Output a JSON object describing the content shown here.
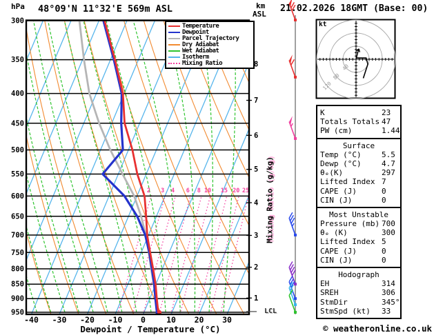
{
  "header": {
    "title": "48°09'N 11°32'E 569m ASL",
    "datetime": "21.02.2026 18GMT (Base: 00)"
  },
  "axes": {
    "pressure_unit": "hPa",
    "km_unit": "km",
    "asl_label": "ASL",
    "xlabel": "Dewpoint / Temperature (°C)",
    "mixing_axis_label": "Mixing Ratio (g/kg)",
    "lcl_label": "LCL",
    "pressure_ticks": [
      300,
      350,
      400,
      450,
      500,
      550,
      600,
      650,
      700,
      750,
      800,
      850,
      900,
      950
    ],
    "temp_ticks": [
      -40,
      -30,
      -20,
      -10,
      0,
      10,
      20,
      30
    ],
    "km_ticks": [
      {
        "km": 1,
        "p": 898
      },
      {
        "km": 2,
        "p": 795
      },
      {
        "km": 3,
        "p": 701
      },
      {
        "km": 4,
        "p": 616
      },
      {
        "km": 5,
        "p": 540
      },
      {
        "km": 6,
        "p": 472
      },
      {
        "km": 7,
        "p": 411
      },
      {
        "km": 8,
        "p": 356
      }
    ],
    "mixing_ratio_labels": [
      2,
      3,
      4,
      6,
      8,
      10,
      15,
      20,
      25
    ]
  },
  "legend": {
    "items": [
      {
        "label": "Temperature",
        "color": "#e83030",
        "style": "solid"
      },
      {
        "label": "Dewpoint",
        "color": "#2433cc",
        "style": "solid"
      },
      {
        "label": "Parcel Trajectory",
        "color": "#b5b5b5",
        "style": "solid"
      },
      {
        "label": "Dry Adiabat",
        "color": "#f28a30",
        "style": "solid"
      },
      {
        "label": "Wet Adiabat",
        "color": "#2ec42e",
        "style": "solid"
      },
      {
        "label": "Isotherm",
        "color": "#56b5ec",
        "style": "solid"
      },
      {
        "label": "Mixing Ratio",
        "color": "#f5409f",
        "style": "dotted"
      }
    ]
  },
  "chart_data": {
    "type": "skewt-sounding",
    "xlabel": "Dewpoint / Temperature (°C)",
    "xlim_C": [
      -40,
      38
    ],
    "plim_hPa": [
      300,
      955
    ],
    "pressure_hPa": [
      300,
      350,
      400,
      450,
      500,
      550,
      600,
      650,
      700,
      750,
      800,
      850,
      900,
      950,
      955
    ],
    "temperature_C": [
      -58.0,
      -48.4,
      -40.5,
      -35.4,
      -28.6,
      -23.2,
      -17.3,
      -13.7,
      -10.5,
      -6.8,
      -3.3,
      -0.1,
      2.5,
      5.1,
      5.5
    ],
    "dewpoint_C": [
      -58.4,
      -48.8,
      -40.9,
      -36.6,
      -32.0,
      -35.6,
      -24.5,
      -16.9,
      -11.2,
      -7.1,
      -3.7,
      -0.6,
      2.0,
      4.6,
      4.7
    ],
    "parcel_C": [
      -67.0,
      -59.5,
      -52.5,
      -44.5,
      -36.5,
      -28.5,
      -21.0,
      -15.5,
      -11.0,
      -7.3,
      -4.0,
      -0.8,
      2.2,
      5.0,
      5.5
    ],
    "colors": {
      "temperature": "#e83030",
      "dewpoint": "#2433cc",
      "parcel": "#b5b5b5",
      "dry_adiabat": "#f28a30",
      "wet_adiabat": "#2ec42e",
      "isotherm": "#56b5ec",
      "mixing_ratio": "#f5409f",
      "grid": "#000000"
    },
    "wind_barbs": [
      {
        "p": 297,
        "speed_kt": 70,
        "color": "#e83030"
      },
      {
        "p": 375,
        "speed_kt": 60,
        "color": "#e83030"
      },
      {
        "p": 478,
        "speed_kt": 55,
        "color": "#f0409f"
      },
      {
        "p": 700,
        "speed_kt": 35,
        "color": "#2b4bed"
      },
      {
        "p": 850,
        "speed_kt": 40,
        "color": "#8b2fc9"
      },
      {
        "p": 900,
        "speed_kt": 30,
        "color": "#2b4bed"
      },
      {
        "p": 922,
        "speed_kt": 25,
        "color": "#35b5ec"
      },
      {
        "p": 950,
        "speed_kt": 10,
        "color": "#2ec42e"
      }
    ],
    "hodograph": {
      "unit_label": "kt",
      "rings_kt": [
        40,
        80,
        120
      ],
      "trace_uv_kt": [
        [
          2,
          4
        ],
        [
          31,
          4
        ],
        [
          36,
          -15
        ],
        [
          22,
          -58
        ]
      ],
      "storm_dir_deg": 345,
      "storm_speed_kt": 33
    }
  },
  "stats_panels": [
    {
      "rows": [
        {
          "label": "K",
          "value": "23"
        },
        {
          "label": "Totals Totals",
          "value": "47"
        },
        {
          "label": "PW (cm)",
          "value": "1.44"
        }
      ]
    },
    {
      "title": "Surface",
      "rows": [
        {
          "label": "Temp (°C)",
          "value": "5.5"
        },
        {
          "label": "Dewp (°C)",
          "value": "4.7"
        },
        {
          "label": "θₑ(K)",
          "value": "297"
        },
        {
          "label": "Lifted Index",
          "value": "7"
        },
        {
          "label": "CAPE (J)",
          "value": "0"
        },
        {
          "label": "CIN (J)",
          "value": "0"
        }
      ]
    },
    {
      "title": "Most Unstable",
      "rows": [
        {
          "label": "Pressure (mb)",
          "value": "700"
        },
        {
          "label": "θₑ (K)",
          "value": "300"
        },
        {
          "label": "Lifted Index",
          "value": "5"
        },
        {
          "label": "CAPE (J)",
          "value": "0"
        },
        {
          "label": "CIN (J)",
          "value": "0"
        }
      ]
    },
    {
      "title": "Hodograph",
      "rows": [
        {
          "label": "EH",
          "value": "314"
        },
        {
          "label": "SREH",
          "value": "306"
        },
        {
          "label": "StmDir",
          "value": "345°"
        },
        {
          "label": "StmSpd (kt)",
          "value": "33"
        }
      ]
    }
  ],
  "footer": {
    "credit": "© weatheronline.co.uk"
  }
}
